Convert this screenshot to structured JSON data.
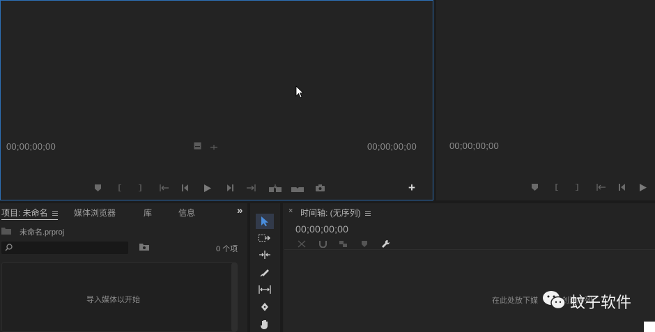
{
  "source_monitor": {
    "timecode_left": "00;00;00;00",
    "timecode_right": "00;00;00;00",
    "add_button": "+"
  },
  "program_monitor": {
    "timecode_left": "00;00;00;00"
  },
  "project_panel": {
    "tabs": [
      {
        "label": "项目: 未命名"
      },
      {
        "label": "媒体浏览器"
      },
      {
        "label": "库"
      },
      {
        "label": "信息"
      }
    ],
    "overflow": "»",
    "project_file": "未命名.prproj",
    "search": {
      "value": "",
      "placeholder": ""
    },
    "item_count": "0 个项",
    "empty_message": "导入媒体以开始"
  },
  "tools": [
    {
      "name": "selection-tool"
    },
    {
      "name": "track-select-tool"
    },
    {
      "name": "ripple-edit-tool"
    },
    {
      "name": "razor-tool"
    },
    {
      "name": "slip-tool"
    },
    {
      "name": "pen-tool"
    },
    {
      "name": "hand-tool"
    }
  ],
  "timeline_panel": {
    "close": "×",
    "title": "时间轴: (无序列)",
    "timecode": "00;00;00;00",
    "drop_hint": "在此处放下媒",
    "drop_hint_tail": "创建序列"
  },
  "watermark": {
    "text": "蚊子软件"
  },
  "colors": {
    "panel_bg": "#232323",
    "app_bg": "#1b1b1b",
    "focus_border": "#2d6fb5",
    "active_tool": "#4a8ede"
  }
}
